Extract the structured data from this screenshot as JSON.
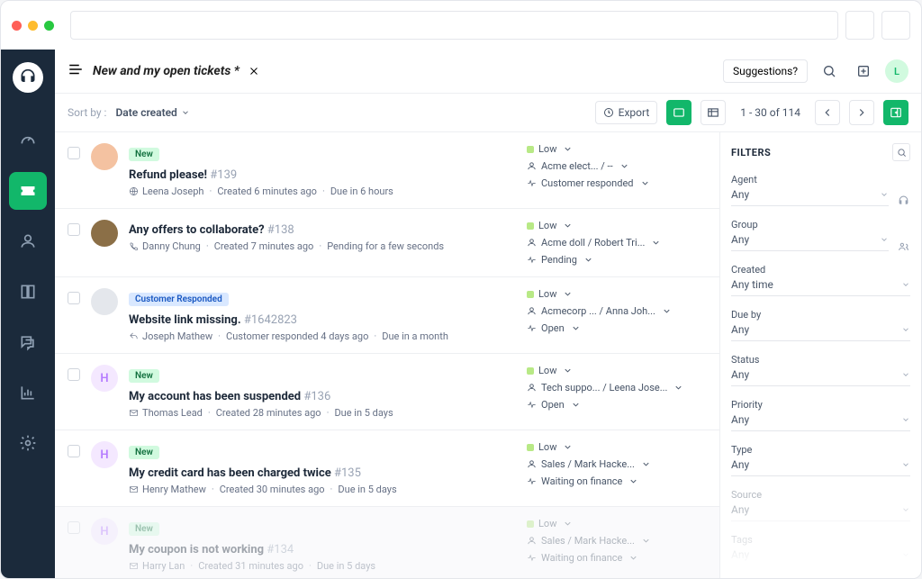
{
  "header": {
    "view_title": "New and my open tickets *",
    "suggestions_label": "Suggestions?",
    "avatar_initial": "L"
  },
  "toolbar": {
    "sort_label": "Sort by :",
    "sort_value": "Date created",
    "export_label": "Export",
    "pagination": "1 - 30 of 114"
  },
  "tickets": [
    {
      "badge": "New",
      "badge_type": "new",
      "subject": "Refund please!",
      "number": "#139",
      "requester": "Leena Joseph",
      "line2_a": "Created 6 minutes ago",
      "line2_b": "Due in 6 hours",
      "priority": "Low",
      "assign": "Acme elect... / --",
      "status": "Customer responded",
      "avatar_bg": "#f4c2a1",
      "avatar_initial": "",
      "meta_icon": "globe"
    },
    {
      "badge": "",
      "subject": "Any offers to collaborate?",
      "number": "#138",
      "requester": "Danny Chung",
      "line2_a": "Created 7 minutes ago",
      "line2_b": "Pending for a few seconds",
      "priority": "Low",
      "assign": "Acme doll / Robert Tri...",
      "status": "Pending",
      "avatar_bg": "#8b6f47",
      "avatar_initial": "",
      "meta_icon": "phone"
    },
    {
      "badge": "Customer Responded",
      "badge_type": "cr",
      "subject": "Website link missing.",
      "number": "#1642823",
      "requester": "Joseph Mathew",
      "line2_a": "Customer responded 4 days ago",
      "line2_b": "Due in a month",
      "priority": "Low",
      "assign": "Acmecorp ... / Anna Joh...",
      "status": "Open",
      "avatar_bg": "#e4e7ec",
      "avatar_initial": "",
      "meta_icon": "reply"
    },
    {
      "badge": "New",
      "badge_type": "new",
      "subject": "My account has been suspended",
      "number": "#136",
      "requester": "Thomas Lead",
      "line2_a": "Created 28 minutes ago",
      "line2_b": "Due in 5 days",
      "priority": "Low",
      "assign": "Tech suppo... / Leena Jose...",
      "status": "Open",
      "avatar_bg": "#f4e8ff",
      "avatar_initial": "H",
      "avatar_color": "#b57bff",
      "meta_icon": "mail"
    },
    {
      "badge": "New",
      "badge_type": "new",
      "subject": "My credit card has been charged twice",
      "number": "#135",
      "requester": "Henry Mathew",
      "line2_a": "Created 30 minutes ago",
      "line2_b": "Due in 5 days",
      "priority": "Low",
      "assign": "Sales / Mark Hacke...",
      "status": "Waiting on finance",
      "avatar_bg": "#f4e8ff",
      "avatar_initial": "H",
      "avatar_color": "#b57bff",
      "meta_icon": "mail"
    },
    {
      "badge": "New",
      "badge_type": "new",
      "subject": "My coupon is not working",
      "number": "#134",
      "requester": "Harry Lan",
      "line2_a": "Created 31 minutes ago",
      "line2_b": "Due in 5 days",
      "priority": "Low",
      "assign": "Sales / Mark Hacke...",
      "status": "Waiting on finance",
      "avatar_bg": "#f4e8ff",
      "avatar_initial": "H",
      "avatar_color": "#b57bff",
      "meta_icon": "mail",
      "faded": true
    }
  ],
  "filters": {
    "title": "FILTERS",
    "groups": [
      {
        "label": "Agent",
        "value": "Any",
        "side_icon": "headset"
      },
      {
        "label": "Group",
        "value": "Any",
        "side_icon": "people"
      },
      {
        "label": "Created",
        "value": "Any time"
      },
      {
        "label": "Due by",
        "value": "Any"
      },
      {
        "label": "Status",
        "value": "Any"
      },
      {
        "label": "Priority",
        "value": "Any"
      },
      {
        "label": "Type",
        "value": "Any"
      },
      {
        "label": "Source",
        "value": "Any",
        "faded": true
      },
      {
        "label": "Tags",
        "value": "Any",
        "faded": true
      }
    ]
  }
}
